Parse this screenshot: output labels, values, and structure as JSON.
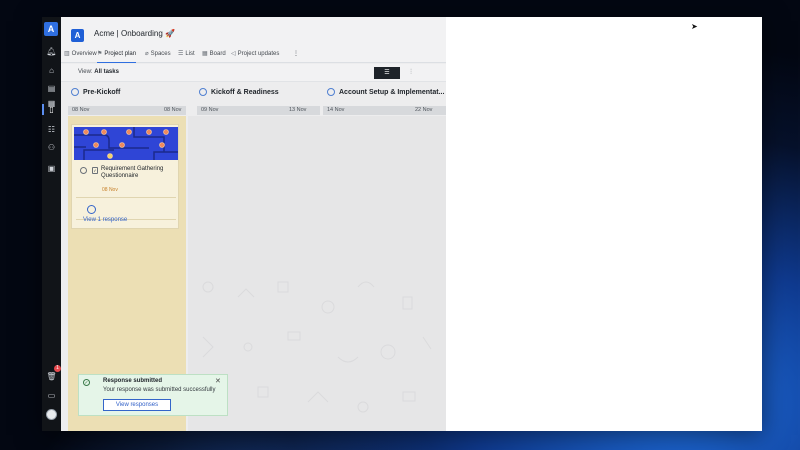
{
  "project": {
    "avatar_letter": "A",
    "title": "Acme | Onboarding 🚀"
  },
  "tabs": [
    {
      "label": "Overview",
      "icon": "chart-icon"
    },
    {
      "label": "Project plan",
      "icon": "plan-icon",
      "active": true
    },
    {
      "label": "Spaces",
      "icon": "clip-icon"
    },
    {
      "label": "List",
      "icon": "list-icon"
    },
    {
      "label": "Board",
      "icon": "board-icon"
    },
    {
      "label": "Project updates",
      "icon": "megaphone-icon"
    },
    {
      "label": "⋮",
      "icon": "more-icon"
    }
  ],
  "toolbar": {
    "view_prefix": "View:",
    "view_value": "All tasks"
  },
  "phases": [
    {
      "name": "Pre-Kickoff",
      "start": "08 Nov",
      "end": "08 Nov"
    },
    {
      "name": "Kickoff & Readiness",
      "start": "09 Nov",
      "end": "13 Nov"
    },
    {
      "name": "Account Setup & Implementat...",
      "start": "14 Nov",
      "end": "22 Nov"
    }
  ],
  "card": {
    "task_name": "Requirement Gathering Questionnaire",
    "due": "08 Nov",
    "view_responses_link": "View 1 response"
  },
  "toast": {
    "title": "Response submitted",
    "message": "Your response was submitted successfully",
    "button": "View responses",
    "close": "✕"
  },
  "rail": {
    "logo_letter": "A",
    "badge_count": "1"
  },
  "colors": {
    "accent": "#2f6fe0",
    "highlight_column": "#ecdfb4",
    "toast_bg": "#e5f5e8",
    "due_date": "#c7802a"
  }
}
